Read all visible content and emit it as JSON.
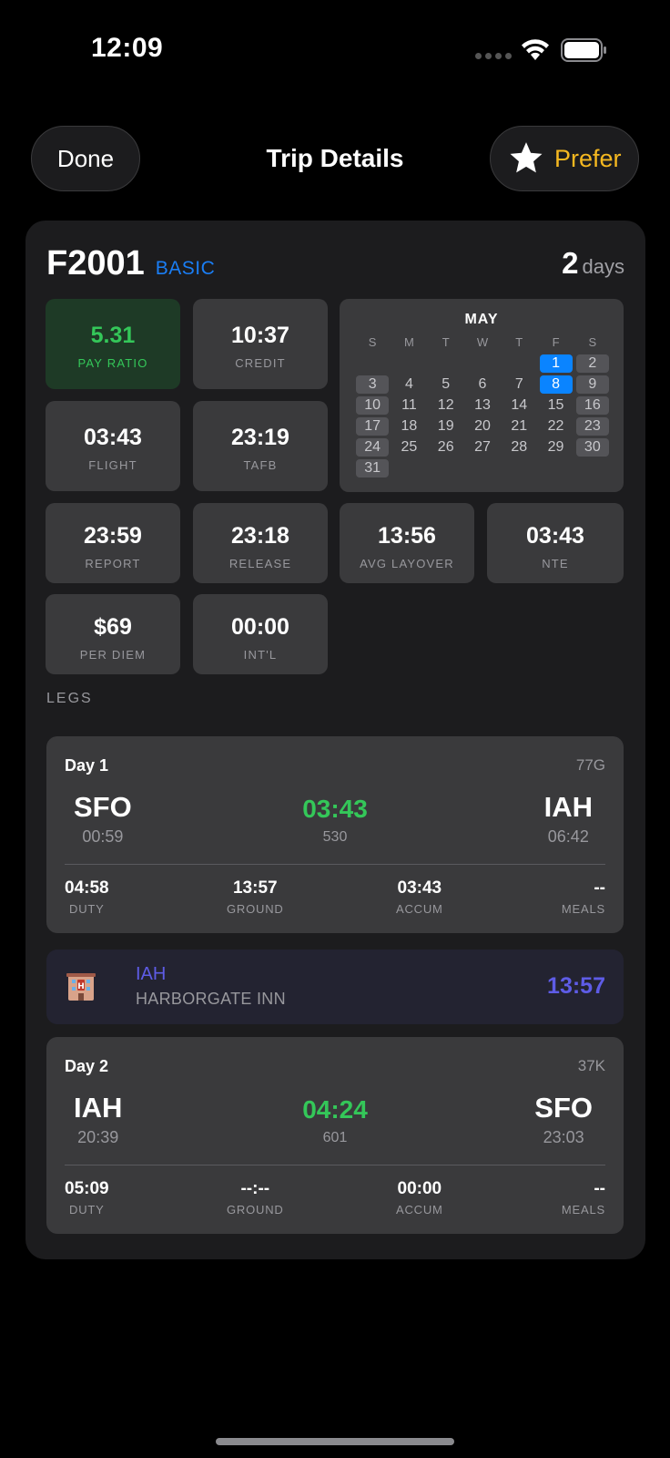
{
  "status": {
    "time": "12:09"
  },
  "nav": {
    "done": "Done",
    "title": "Trip Details",
    "prefer": "Prefer"
  },
  "colors": {
    "accent_blue": "#0a84ff",
    "green": "#34c759",
    "gold": "#f5b820",
    "indigo": "#5e5ce6"
  },
  "trip": {
    "id": "F2001",
    "type": "BASIC",
    "days_num": "2",
    "days_label": "days"
  },
  "stats": {
    "pay_ratio": {
      "value": "5.31",
      "label": "PAY RATIO"
    },
    "credit": {
      "value": "10:37",
      "label": "CREDIT"
    },
    "flight": {
      "value": "03:43",
      "label": "FLIGHT"
    },
    "tafb": {
      "value": "23:19",
      "label": "TAFB"
    },
    "report": {
      "value": "23:59",
      "label": "REPORT"
    },
    "release": {
      "value": "23:18",
      "label": "RELEASE"
    },
    "avg_layover": {
      "value": "13:56",
      "label": "AVG LAYOVER"
    },
    "nte": {
      "value": "03:43",
      "label": "NTE"
    },
    "per_diem": {
      "value": "$69",
      "label": "PER DIEM"
    },
    "intl": {
      "value": "00:00",
      "label": "INT'L"
    }
  },
  "calendar": {
    "month": "MAY",
    "dow": [
      "S",
      "M",
      "T",
      "W",
      "T",
      "F",
      "S"
    ],
    "weeks": [
      [
        "",
        "",
        "",
        "",
        "",
        "1",
        "2"
      ],
      [
        "3",
        "4",
        "5",
        "6",
        "7",
        "8",
        "9"
      ],
      [
        "10",
        "11",
        "12",
        "13",
        "14",
        "15",
        "16"
      ],
      [
        "17",
        "18",
        "19",
        "20",
        "21",
        "22",
        "23"
      ],
      [
        "24",
        "25",
        "26",
        "27",
        "28",
        "29",
        "30"
      ],
      [
        "31",
        "",
        "",
        "",
        "",
        "",
        ""
      ]
    ],
    "selected": [
      "1",
      "8"
    ]
  },
  "legs_label": "LEGS",
  "legs": [
    {
      "day": "Day 1",
      "equipment": "77G",
      "dep_code": "SFO",
      "dep_time": "00:59",
      "block": "03:43",
      "flight": "530",
      "arr_code": "IAH",
      "arr_time": "06:42",
      "duty": "04:58",
      "duty_label": "DUTY",
      "ground": "13:57",
      "ground_label": "GROUND",
      "accum": "03:43",
      "accum_label": "ACCUM",
      "meals": "--",
      "meals_label": "MEALS"
    },
    {
      "day": "Day 2",
      "equipment": "37K",
      "dep_code": "IAH",
      "dep_time": "20:39",
      "block": "04:24",
      "flight": "601",
      "arr_code": "SFO",
      "arr_time": "23:03",
      "duty": "05:09",
      "duty_label": "DUTY",
      "ground": "--:--",
      "ground_label": "GROUND",
      "accum": "00:00",
      "accum_label": "ACCUM",
      "meals": "--",
      "meals_label": "MEALS"
    }
  ],
  "layover": {
    "code": "IAH",
    "hotel": "HARBORGATE INN",
    "time": "13:57",
    "icon": "hotel-icon"
  }
}
